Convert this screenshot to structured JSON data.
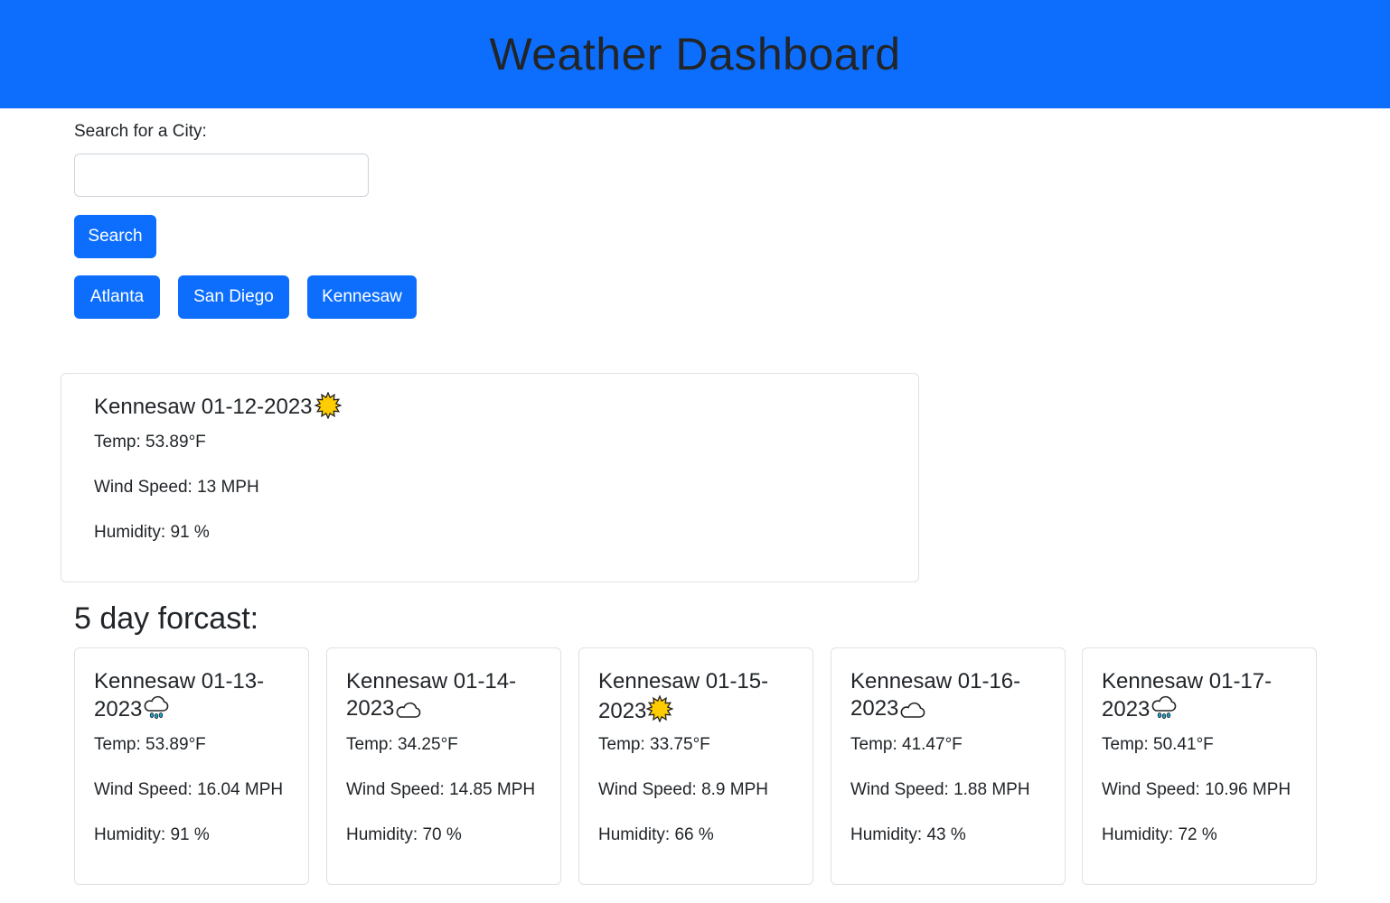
{
  "header": {
    "title": "Weather Dashboard"
  },
  "search": {
    "label": "Search for a City:",
    "value": "",
    "placeholder": "",
    "button_label": "Search"
  },
  "history": [
    "Atlanta",
    "San Diego",
    "Kennesaw"
  ],
  "current": {
    "city_date": "Kennesaw 01-12-2023",
    "icon": "sun-icon",
    "temp": "Temp: 53.89°F",
    "wind": "Wind Speed: 13 MPH",
    "humidity": "Humidity: 91 %"
  },
  "forecast_heading": "5 day forcast:",
  "forecast": [
    {
      "city_date": "Kennesaw 01-13-2023",
      "icon": "rain-icon",
      "temp": "Temp: 53.89°F",
      "wind": "Wind Speed: 16.04 MPH",
      "humidity": "Humidity: 91 %"
    },
    {
      "city_date": "Kennesaw 01-14-2023",
      "icon": "cloud-icon",
      "temp": "Temp: 34.25°F",
      "wind": "Wind Speed: 14.85 MPH",
      "humidity": "Humidity: 70 %"
    },
    {
      "city_date": "Kennesaw 01-15-2023",
      "icon": "sun-icon",
      "temp": "Temp: 33.75°F",
      "wind": "Wind Speed: 8.9 MPH",
      "humidity": "Humidity: 66 %"
    },
    {
      "city_date": "Kennesaw 01-16-2023",
      "icon": "cloud-icon",
      "temp": "Temp: 41.47°F",
      "wind": "Wind Speed: 1.88 MPH",
      "humidity": "Humidity: 43 %"
    },
    {
      "city_date": "Kennesaw 01-17-2023",
      "icon": "rain-icon",
      "temp": "Temp: 50.41°F",
      "wind": "Wind Speed: 10.96 MPH",
      "humidity": "Humidity: 72 %"
    }
  ],
  "colors": {
    "primary": "#0d6efd",
    "text": "#212529",
    "border": "#dee2e6",
    "sun": "#ffcc00"
  }
}
